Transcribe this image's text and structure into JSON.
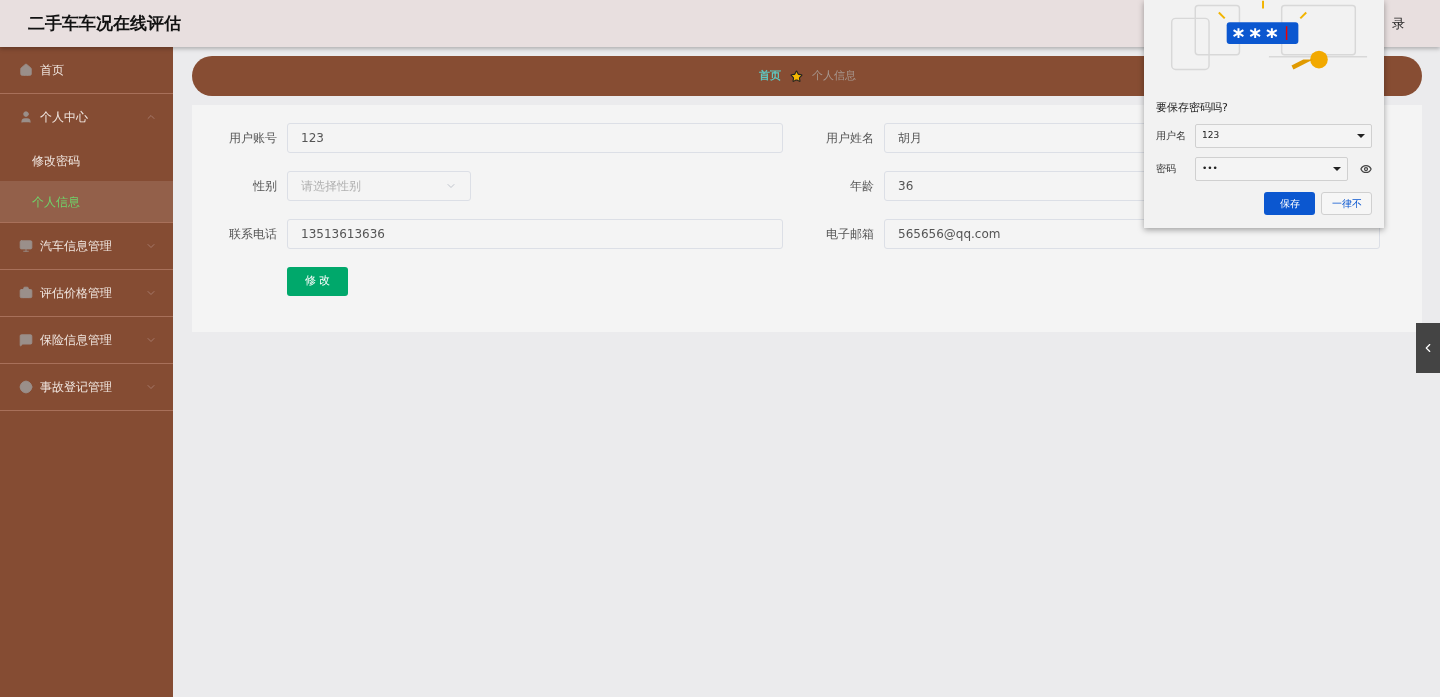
{
  "header": {
    "title": "二手车车况在线评估",
    "right_link": "录"
  },
  "sidebar": {
    "items": [
      {
        "label": "首页",
        "kind": "link"
      },
      {
        "label": "个人中心",
        "kind": "group",
        "expanded": true,
        "children": [
          {
            "label": "修改密码",
            "selected": false
          },
          {
            "label": "个人信息",
            "selected": true
          }
        ]
      },
      {
        "label": "汽车信息管理",
        "kind": "group",
        "expanded": false
      },
      {
        "label": "评估价格管理",
        "kind": "group",
        "expanded": false
      },
      {
        "label": "保险信息管理",
        "kind": "group",
        "expanded": false
      },
      {
        "label": "事故登记管理",
        "kind": "group",
        "expanded": false
      }
    ]
  },
  "breadcrumb": [
    {
      "label": "首页",
      "current": false
    },
    {
      "label": "个人信息",
      "current": true
    }
  ],
  "form": {
    "fields": [
      {
        "label": "用户账号",
        "kind": "text",
        "value": "123"
      },
      {
        "label": "用户姓名",
        "kind": "text",
        "value": "胡月"
      },
      {
        "label": "性别",
        "kind": "select",
        "placeholder": "请选择性别"
      },
      {
        "label": "年龄",
        "kind": "text",
        "value": "36"
      },
      {
        "label": "联系电话",
        "kind": "text",
        "value": "13513613636"
      },
      {
        "label": "电子邮箱",
        "kind": "text",
        "value": "565656@qq.com"
      }
    ],
    "submit": "修 改"
  },
  "save_password_popup": {
    "title": "要保存密码吗?",
    "username_label": "用户名",
    "username": "123",
    "password_label": "密码",
    "password": "•••",
    "buttons": [
      {
        "label": "保存",
        "kind": "primary"
      },
      {
        "label": "一律不",
        "kind": "secondary"
      }
    ]
  }
}
